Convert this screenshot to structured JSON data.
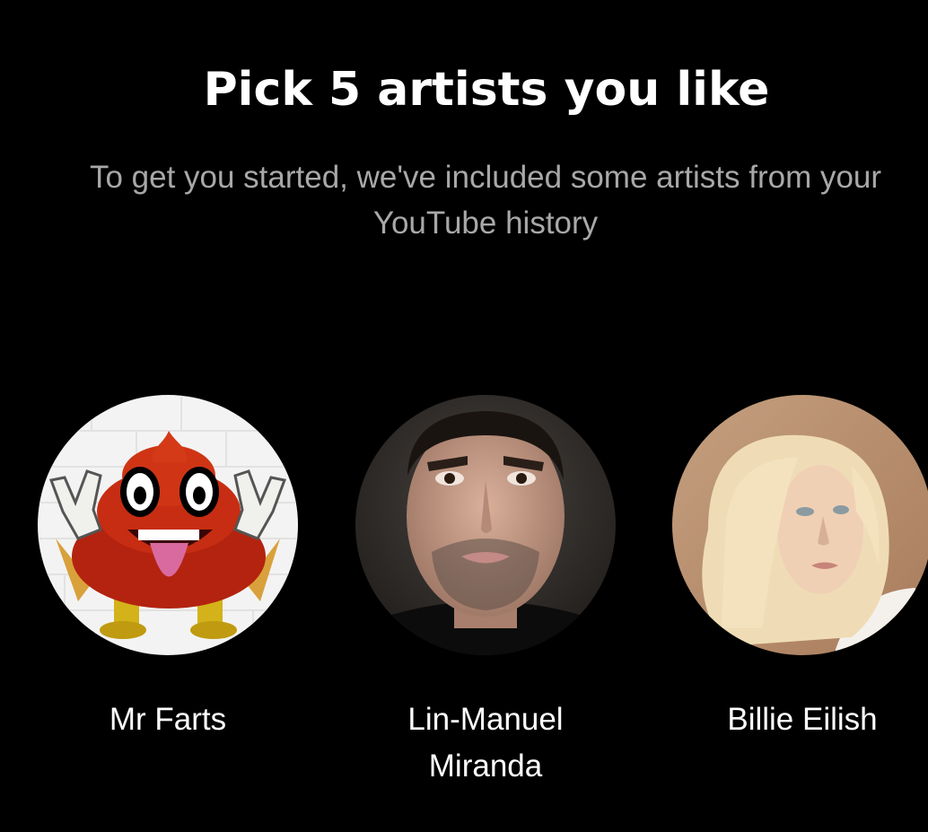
{
  "header": {
    "title": "Pick 5 artists you like",
    "subtitle": "To get you started, we've included some artists from your YouTube history"
  },
  "artists": [
    {
      "name": "Mr Farts",
      "avatar": "poop-cartoon-avatar"
    },
    {
      "name": "Lin-Manuel Miranda",
      "avatar": "man-portrait-avatar"
    },
    {
      "name": "Billie Eilish",
      "avatar": "blonde-woman-portrait-avatar"
    }
  ],
  "colors": {
    "background": "#000000",
    "title": "#ffffff",
    "subtitle": "#a8a8a8",
    "artist_name": "#ffffff"
  }
}
